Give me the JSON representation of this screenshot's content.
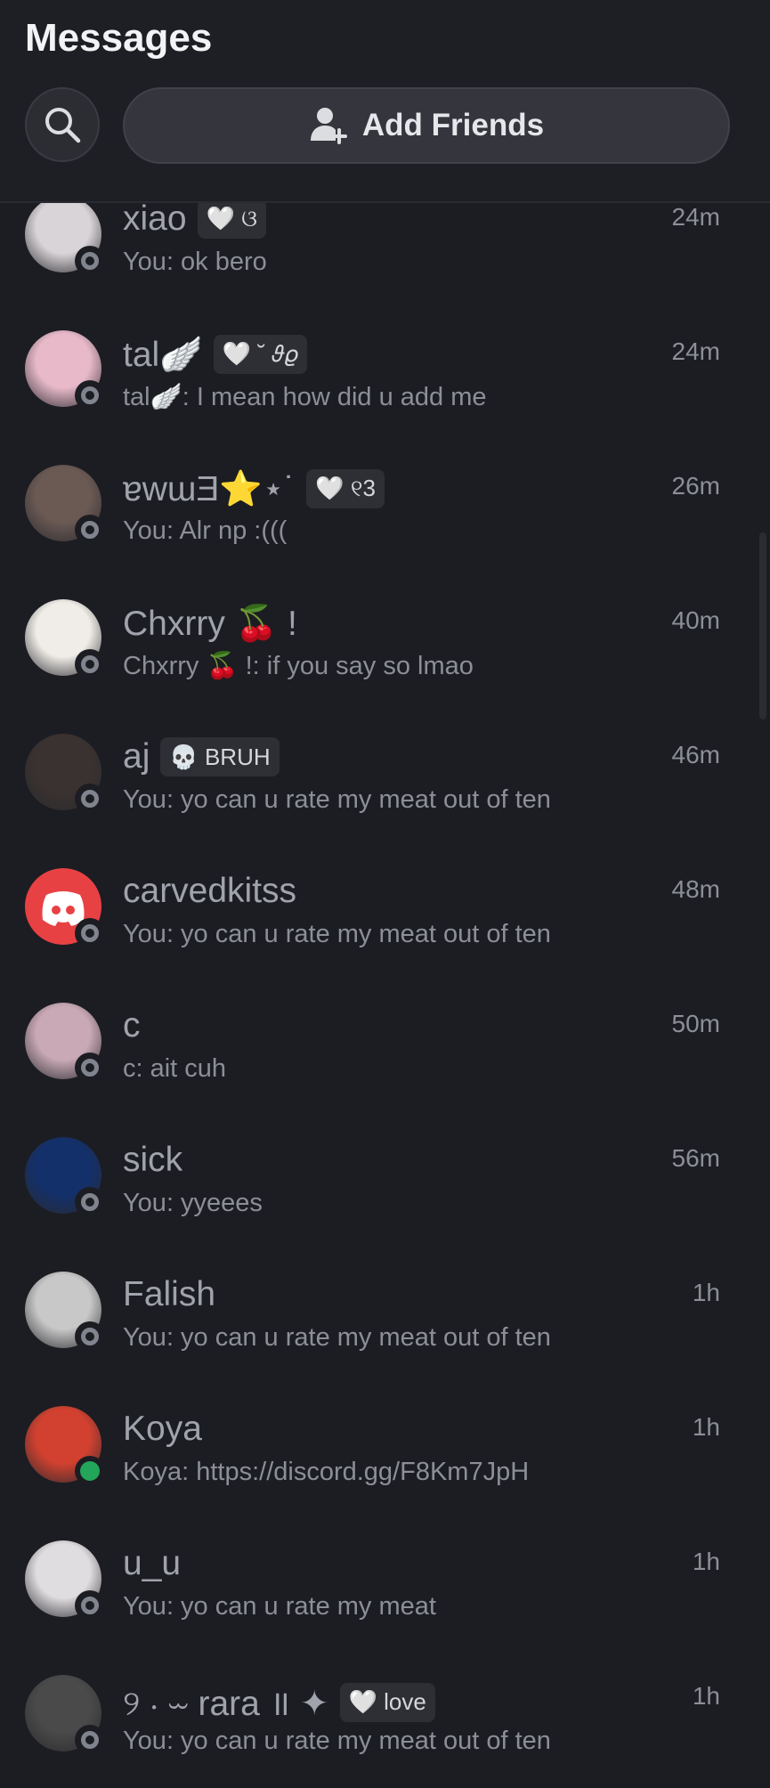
{
  "header": {
    "title": "Messages",
    "search_icon": "search-icon",
    "add_friends_label": "Add Friends",
    "add_friends_icon": "add-user-icon"
  },
  "conversations": [
    {
      "name": "xiao",
      "tag": "🤍 ଓ",
      "preview": "You: ok bero",
      "time": "24m",
      "status": "offline",
      "avatar_color": "#d9d4d8"
    },
    {
      "name": "tal🪽",
      "tag": "🤍 ˘ 𝜗𝜚",
      "preview": "tal🪽: I mean how did u add me",
      "time": "24m",
      "status": "offline",
      "avatar_color": "#e8b9c9"
    },
    {
      "name": "ɐwɯƎ⭐⋆˙",
      "tag": "🤍 ୧3",
      "preview": "You: Alr np :(((",
      "time": "26m",
      "status": "offline",
      "avatar_color": "#6b5a54"
    },
    {
      "name": "Chxrry 🍒 !",
      "tag": "",
      "preview": "Chxrry 🍒 !: if you say so lmao",
      "time": "40m",
      "status": "offline",
      "avatar_color": "#f0ede8"
    },
    {
      "name": "aj",
      "tag": "💀 BRUH",
      "preview": "You: yo can u rate my meat out of ten",
      "time": "46m",
      "status": "offline",
      "avatar_color": "#3a3230"
    },
    {
      "name": "carvedkitss",
      "tag": "",
      "preview": "You: yo can u rate my meat out of ten",
      "time": "48m",
      "status": "offline",
      "avatar_color": "#e84144"
    },
    {
      "name": "c",
      "tag": "",
      "preview": "c: ait cuh",
      "time": "50m",
      "status": "offline",
      "avatar_color": "#c9a9b6"
    },
    {
      "name": "sick",
      "tag": "",
      "preview": "You: yyeees",
      "time": "56m",
      "status": "offline",
      "avatar_color": "#13306b"
    },
    {
      "name": "Falish",
      "tag": "",
      "preview": "You: yo can u rate my meat out of ten",
      "time": "1h",
      "status": "offline",
      "avatar_color": "#c8c8c8"
    },
    {
      "name": "Koya",
      "tag": "",
      "preview": "Koya: https://discord.gg/F8Km7JpH",
      "time": "1h",
      "status": "online",
      "avatar_color": "#d2412f"
    },
    {
      "name": "u_u",
      "tag": "",
      "preview": "You: yo can u rate my meat",
      "time": "1h",
      "status": "offline",
      "avatar_color": "#e0dde0"
    },
    {
      "name": "୨ ‧ ⏖ rara ॥ ✦",
      "tag": "🤍 love",
      "preview": "You: yo can u rate my meat out of ten",
      "time": "1h",
      "status": "offline",
      "avatar_color": "#4a4a4a"
    }
  ]
}
